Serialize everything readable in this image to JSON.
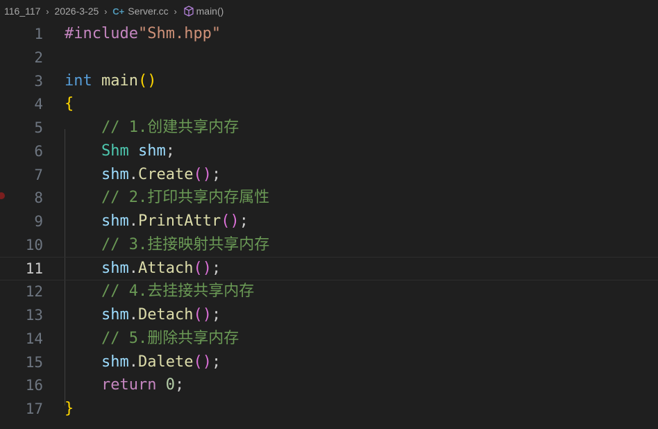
{
  "breadcrumb": {
    "folder": "116_117",
    "subfolder": "2026-3-25",
    "file_icon": "c-plus-plus-icon",
    "file_icon_glyph": "C+",
    "file": "Server.cc",
    "symbol_icon": "cube-icon",
    "symbol": "main()",
    "separator": "›"
  },
  "editor": {
    "active_line": "11",
    "breakpoint_line": "8",
    "lines": [
      {
        "n": "1",
        "tokens": [
          [
            "#include",
            "pre"
          ],
          [
            "\"Shm.hpp\"",
            "str"
          ]
        ]
      },
      {
        "n": "2",
        "tokens": []
      },
      {
        "n": "3",
        "tokens": [
          [
            "int",
            "kw"
          ],
          [
            " ",
            "plain"
          ],
          [
            "main",
            "fn"
          ],
          [
            "()",
            "par1"
          ]
        ]
      },
      {
        "n": "4",
        "tokens": [
          [
            "{",
            "par1"
          ]
        ]
      },
      {
        "n": "5",
        "tokens": [
          [
            "    // 1.创建共享内存",
            "cmt"
          ]
        ]
      },
      {
        "n": "6",
        "tokens": [
          [
            "    ",
            "plain"
          ],
          [
            "Shm",
            "type"
          ],
          [
            " ",
            "plain"
          ],
          [
            "shm",
            "var"
          ],
          [
            ";",
            "plain"
          ]
        ]
      },
      {
        "n": "7",
        "tokens": [
          [
            "    ",
            "plain"
          ],
          [
            "shm",
            "var"
          ],
          [
            ".",
            "plain"
          ],
          [
            "Create",
            "fn"
          ],
          [
            "()",
            "par2"
          ],
          [
            ";",
            "plain"
          ]
        ]
      },
      {
        "n": "8",
        "tokens": [
          [
            "    // 2.打印共享内存属性",
            "cmt"
          ]
        ]
      },
      {
        "n": "9",
        "tokens": [
          [
            "    ",
            "plain"
          ],
          [
            "shm",
            "var"
          ],
          [
            ".",
            "plain"
          ],
          [
            "PrintAttr",
            "fn"
          ],
          [
            "()",
            "par2"
          ],
          [
            ";",
            "plain"
          ]
        ]
      },
      {
        "n": "10",
        "tokens": [
          [
            "    // 3.挂接映射共享内存",
            "cmt"
          ]
        ]
      },
      {
        "n": "11",
        "tokens": [
          [
            "    ",
            "plain"
          ],
          [
            "shm",
            "var"
          ],
          [
            ".",
            "plain"
          ],
          [
            "Attach",
            "fn"
          ],
          [
            "()",
            "par2"
          ],
          [
            ";",
            "plain"
          ]
        ]
      },
      {
        "n": "12",
        "tokens": [
          [
            "    // 4.去挂接共享内存",
            "cmt"
          ]
        ]
      },
      {
        "n": "13",
        "tokens": [
          [
            "    ",
            "plain"
          ],
          [
            "shm",
            "var"
          ],
          [
            ".",
            "plain"
          ],
          [
            "Detach",
            "fn"
          ],
          [
            "()",
            "par2"
          ],
          [
            ";",
            "plain"
          ]
        ]
      },
      {
        "n": "14",
        "tokens": [
          [
            "    // 5.删除共享内存",
            "cmt"
          ]
        ]
      },
      {
        "n": "15",
        "tokens": [
          [
            "    ",
            "plain"
          ],
          [
            "shm",
            "var"
          ],
          [
            ".",
            "plain"
          ],
          [
            "Dalete",
            "fn"
          ],
          [
            "()",
            "par2"
          ],
          [
            ";",
            "plain"
          ]
        ]
      },
      {
        "n": "16",
        "tokens": [
          [
            "    ",
            "plain"
          ],
          [
            "return",
            "ret"
          ],
          [
            " ",
            "plain"
          ],
          [
            "0",
            "num"
          ],
          [
            ";",
            "plain"
          ]
        ]
      },
      {
        "n": "17",
        "tokens": [
          [
            "}",
            "par1"
          ]
        ]
      }
    ]
  },
  "colors": {
    "background": "#1f1f1f",
    "line_number": "#6e7681",
    "line_number_active": "#cccccc",
    "breakpoint": "#7a1e1e"
  }
}
